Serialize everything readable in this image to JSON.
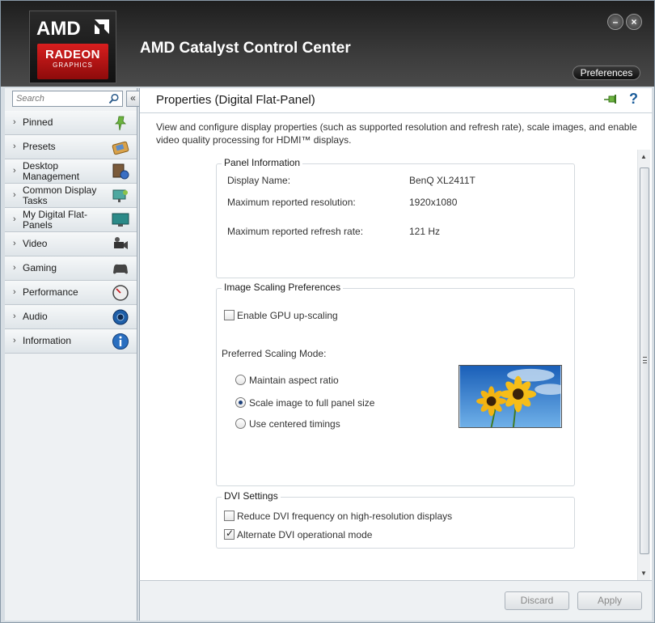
{
  "header": {
    "logo_amd": "AMD",
    "logo_radeon": "RADEON",
    "logo_graphics": "GRAPHICS",
    "app_title": "AMD Catalyst Control Center",
    "preferences_label": "Preferences",
    "minimize_glyph": "–",
    "close_glyph": "×"
  },
  "sidebar": {
    "search_placeholder": "Search",
    "collapse_glyph": "«",
    "items": [
      {
        "label": "Pinned",
        "icon": "pin-icon"
      },
      {
        "label": "Presets",
        "icon": "presets-icon"
      },
      {
        "label": "Desktop Management",
        "icon": "desktop-management-icon"
      },
      {
        "label": "Common Display Tasks",
        "icon": "display-tasks-icon"
      },
      {
        "label": "My Digital Flat-Panels",
        "icon": "flat-panel-icon"
      },
      {
        "label": "Video",
        "icon": "video-camera-icon"
      },
      {
        "label": "Gaming",
        "icon": "gamepad-icon"
      },
      {
        "label": "Performance",
        "icon": "gauge-icon"
      },
      {
        "label": "Audio",
        "icon": "speaker-icon"
      },
      {
        "label": "Information",
        "icon": "info-icon"
      }
    ]
  },
  "main": {
    "title": "Properties (Digital Flat-Panel)",
    "help_glyph": "?",
    "description": "View and configure display properties (such as supported resolution and refresh rate), scale images, and enable video quality processing for HDMI™ displays.",
    "panel_info": {
      "legend": "Panel Information",
      "display_name_label": "Display Name:",
      "display_name_value": "BenQ XL2411T",
      "max_res_label": "Maximum reported resolution:",
      "max_res_value": "1920x1080",
      "max_refresh_label": "Maximum reported refresh rate:",
      "max_refresh_value": "121 Hz"
    },
    "scaling": {
      "legend": "Image Scaling Preferences",
      "gpu_upscaling_label": "Enable GPU up-scaling",
      "gpu_upscaling_checked": false,
      "mode_label": "Preferred Scaling Mode:",
      "options": [
        {
          "label": "Maintain aspect ratio",
          "selected": false
        },
        {
          "label": "Scale image to full panel size",
          "selected": true
        },
        {
          "label": "Use centered timings",
          "selected": false
        }
      ]
    },
    "dvi": {
      "legend": "DVI Settings",
      "reduce_label": "Reduce DVI frequency on high-resolution displays",
      "reduce_checked": false,
      "alternate_label": "Alternate DVI operational mode",
      "alternate_checked": true
    }
  },
  "footer": {
    "discard_label": "Discard",
    "apply_label": "Apply"
  },
  "colors": {
    "accent_red": "#c8161d",
    "header_dark": "#2a2a2a",
    "help_blue": "#1a5c9a"
  }
}
